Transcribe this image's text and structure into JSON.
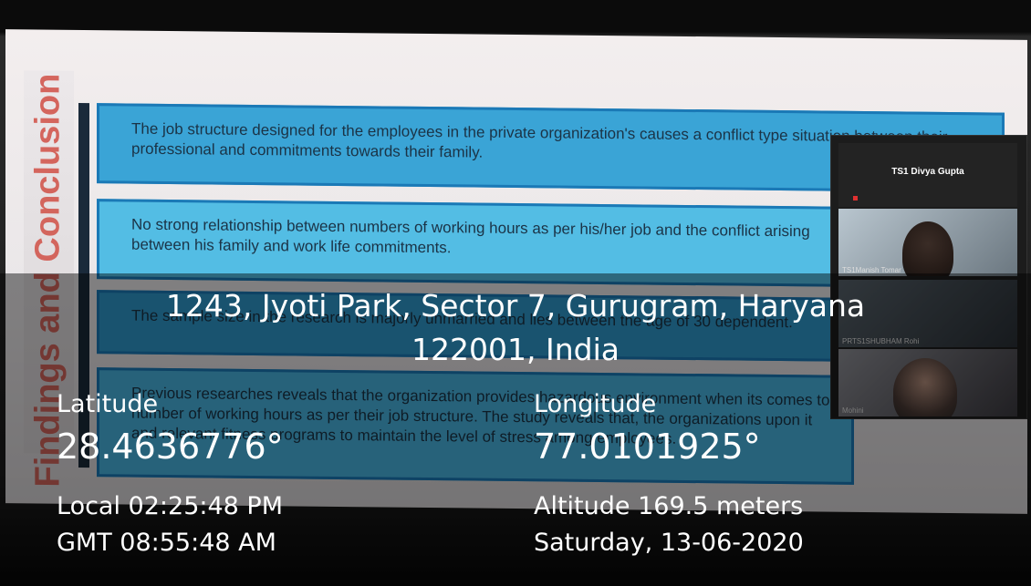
{
  "slide": {
    "vertical_title": "Findings and Conclusion",
    "points": [
      "The job structure designed for the employees in the private organization's causes a conflict type situation between their professional and commitments towards their family.",
      "No strong  relationship between numbers of working hours as per his/her job and the conflict arising between his family and work life commitments.",
      "The sample size in the research is majorly unmarried and lies between the age of 30 dependent.",
      "Previous researches reveals that the organization provides hazardous environment when its comes to number of working hours as per their job structure. The study reveals that, the organizations upon it and relevant fitness programs to maintain the level of stress among employees."
    ]
  },
  "video_call": {
    "participants": [
      {
        "name": "TS1 Divya Gupta"
      },
      {
        "name": "TS1Manish Tomar"
      },
      {
        "name": "PRTS1SHUBHAM Rohi"
      },
      {
        "name": "Mohini"
      }
    ]
  },
  "gps_overlay": {
    "address_line1": "1243, Jyoti Park, Sector 7, Gurugram, Haryana",
    "address_line2": "122001, India",
    "latitude_label": "Latitude",
    "latitude_value": "28.4636776°",
    "longitude_label": "Longitude",
    "longitude_value": "77.0101925°",
    "local_time": "Local 02:25:48 PM",
    "gmt_time": "GMT 08:55:48 AM",
    "altitude": "Altitude 169.5 meters",
    "date": "Saturday, 13-06-2020"
  }
}
